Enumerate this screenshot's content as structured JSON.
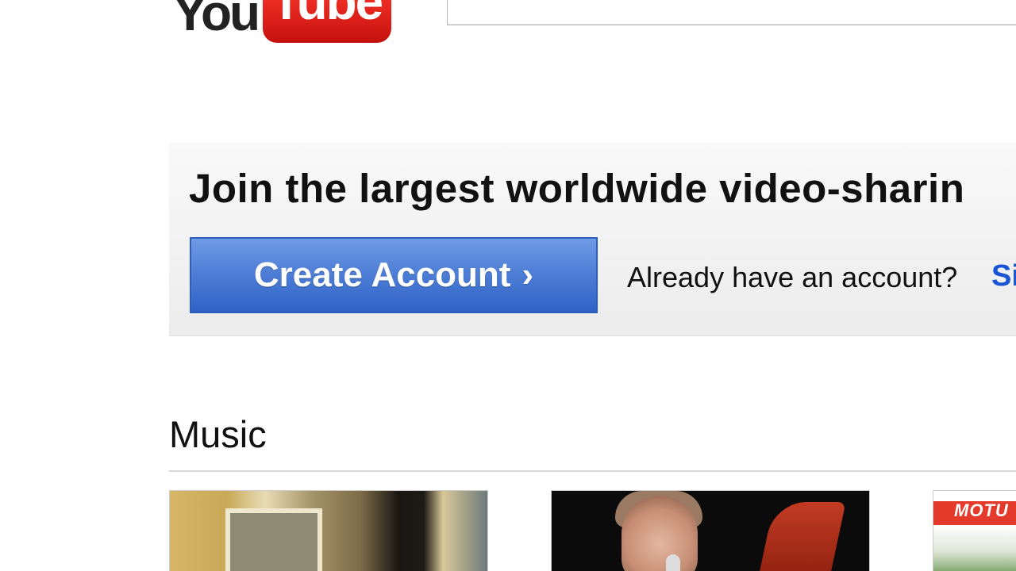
{
  "header": {
    "logo_you": "You",
    "logo_tube": "Tube",
    "search_value": ""
  },
  "promo": {
    "title": "Join the largest worldwide video-sharin",
    "create_account_label": "Create Account",
    "create_account_chevron": "›",
    "already_text": "Already have an account?",
    "signin_label": "Si"
  },
  "sections": {
    "music_title": "Music"
  },
  "thumbnails": {
    "third_overlay_text": "MOTU"
  },
  "colors": {
    "brand_red": "#e62117",
    "button_blue": "#4f7fd6",
    "link_blue": "#1a55d6"
  }
}
